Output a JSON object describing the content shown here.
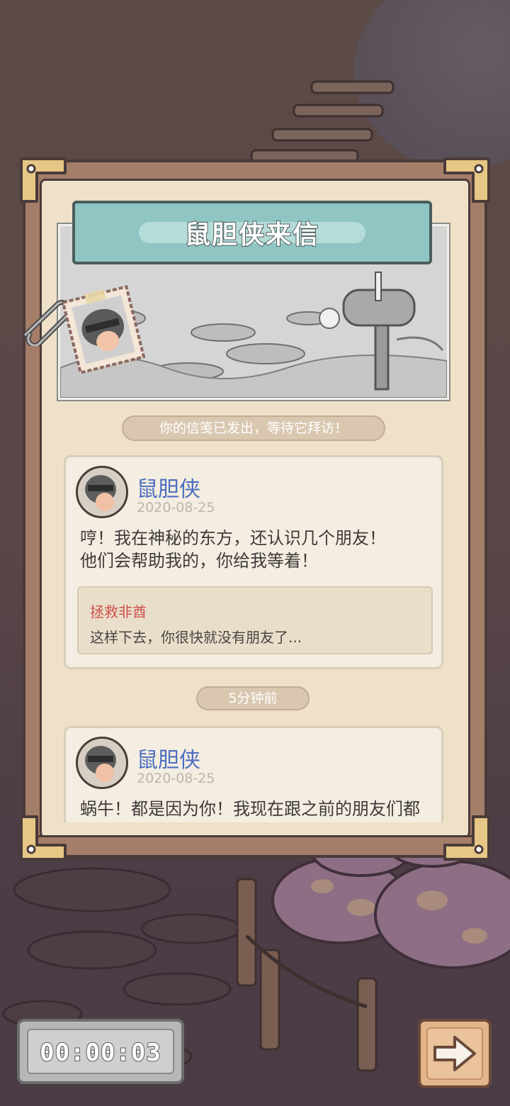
{
  "letter": {
    "title": "鼠胆侠来信",
    "status_text": "你的信笺已发出，等待它拜访！",
    "time_ago": "5分钟前"
  },
  "messages": [
    {
      "sender": "鼠胆侠",
      "date": "2020-08-25",
      "lines": [
        "哼！我在神秘的东方，还认识几个朋友！",
        "他们会帮助我的，你给我等着！"
      ],
      "quote": {
        "title": "拯救非酋",
        "body": "这样下去，你很快就没有朋友了..."
      }
    },
    {
      "sender": "鼠胆侠",
      "date": "2020-08-25",
      "lines": [
        "蜗牛！都是因为你！我现在跟之前的朋友们都"
      ]
    }
  ],
  "timer": {
    "value": "00:00:03"
  },
  "icons": {
    "next": "arrow-right-icon",
    "avatar": "masked-rat-avatar",
    "stamp": "masked-rat-stamp",
    "mailbox": "mailbox-illustration",
    "clip": "paper-clip-icon"
  },
  "colors": {
    "sender_name": "#4c6fbf",
    "quote_title": "#d1504d",
    "banner": "#8fc5c2",
    "panel": "#a57e69",
    "paper": "#eee1c8"
  }
}
